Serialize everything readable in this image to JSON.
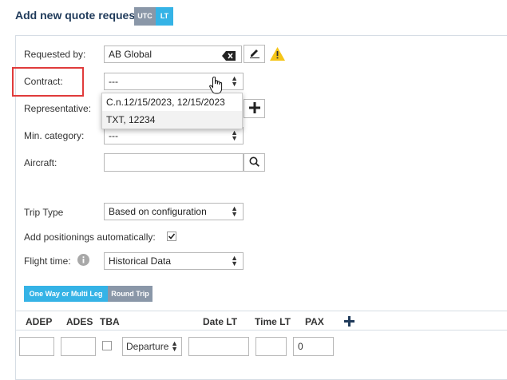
{
  "header": {
    "title": "Add new quote request",
    "badge_utc": "UTC",
    "badge_lt": "LT"
  },
  "form": {
    "requested_by": {
      "label": "Requested by:",
      "value": "AB Global"
    },
    "contract": {
      "label": "Contract:",
      "value": "---",
      "options": [
        "C.n.12/15/2023, 12/15/2023",
        "TXT, 12234"
      ]
    },
    "representative": {
      "label": "Representative:"
    },
    "min_category": {
      "label": "Min. category:",
      "value": "---"
    },
    "aircraft": {
      "label": "Aircraft:",
      "value": ""
    },
    "trip_type": {
      "label": "Trip Type",
      "value": "Based on configuration"
    },
    "add_positionings": {
      "label": "Add positionings automatically:",
      "checked": true
    },
    "flight_time": {
      "label": "Flight time:",
      "value": "Historical Data"
    }
  },
  "tabs": {
    "one_way": "One Way or Multi Leg",
    "round_trip": "Round Trip"
  },
  "legs": {
    "columns": {
      "adep": "ADEP",
      "ades": "ADES",
      "tba": "TBA",
      "date": "Date LT",
      "time": "Time LT",
      "pax": "PAX"
    },
    "row": {
      "adep": "",
      "ades": "",
      "type": "Departure",
      "date": "",
      "time": "",
      "pax": "0"
    }
  },
  "colors": {
    "accent": "#35b3e6",
    "muted": "#8a97a8",
    "warning": "#f5c518",
    "highlight": "#e03b3b"
  }
}
